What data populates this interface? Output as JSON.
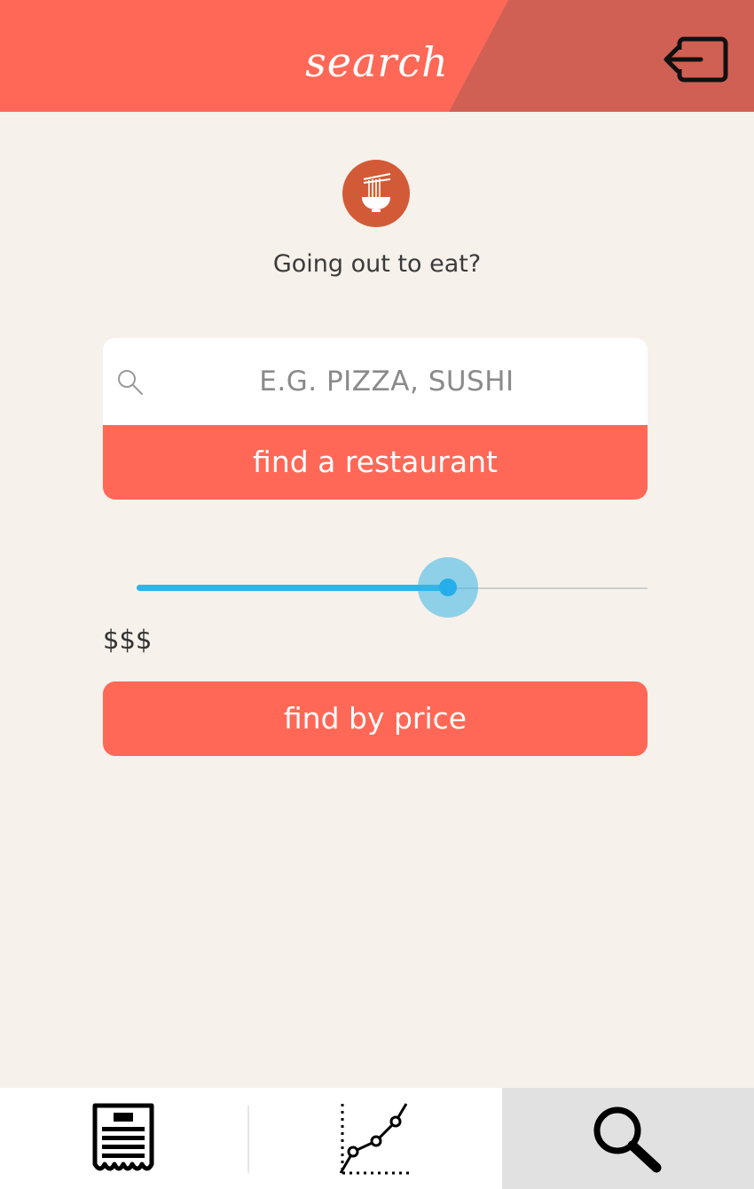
{
  "header": {
    "title": "search",
    "logout_icon": "logout-icon",
    "background_colors": [
      "#ff6857",
      "#d06054"
    ]
  },
  "logo": {
    "icon": "noodle-bowl-icon",
    "color": "#d35a37"
  },
  "tagline": "Going out to eat?",
  "search": {
    "icon": "search-icon",
    "placeholder": "E.G. PIZZA, SUSHI",
    "value": "",
    "button_label": "find a restaurant"
  },
  "price": {
    "slider_level": 0.61,
    "slider_color": "#2bb5ea",
    "label": "$$$",
    "button_label": "find by price"
  },
  "bottom_nav": {
    "tabs": [
      {
        "icon": "receipt-icon",
        "active": false
      },
      {
        "icon": "line-chart-icon",
        "active": false
      },
      {
        "icon": "search-icon",
        "active": true
      }
    ]
  },
  "colors": {
    "accent": "#ff6857",
    "background": "#f6f1ea"
  }
}
